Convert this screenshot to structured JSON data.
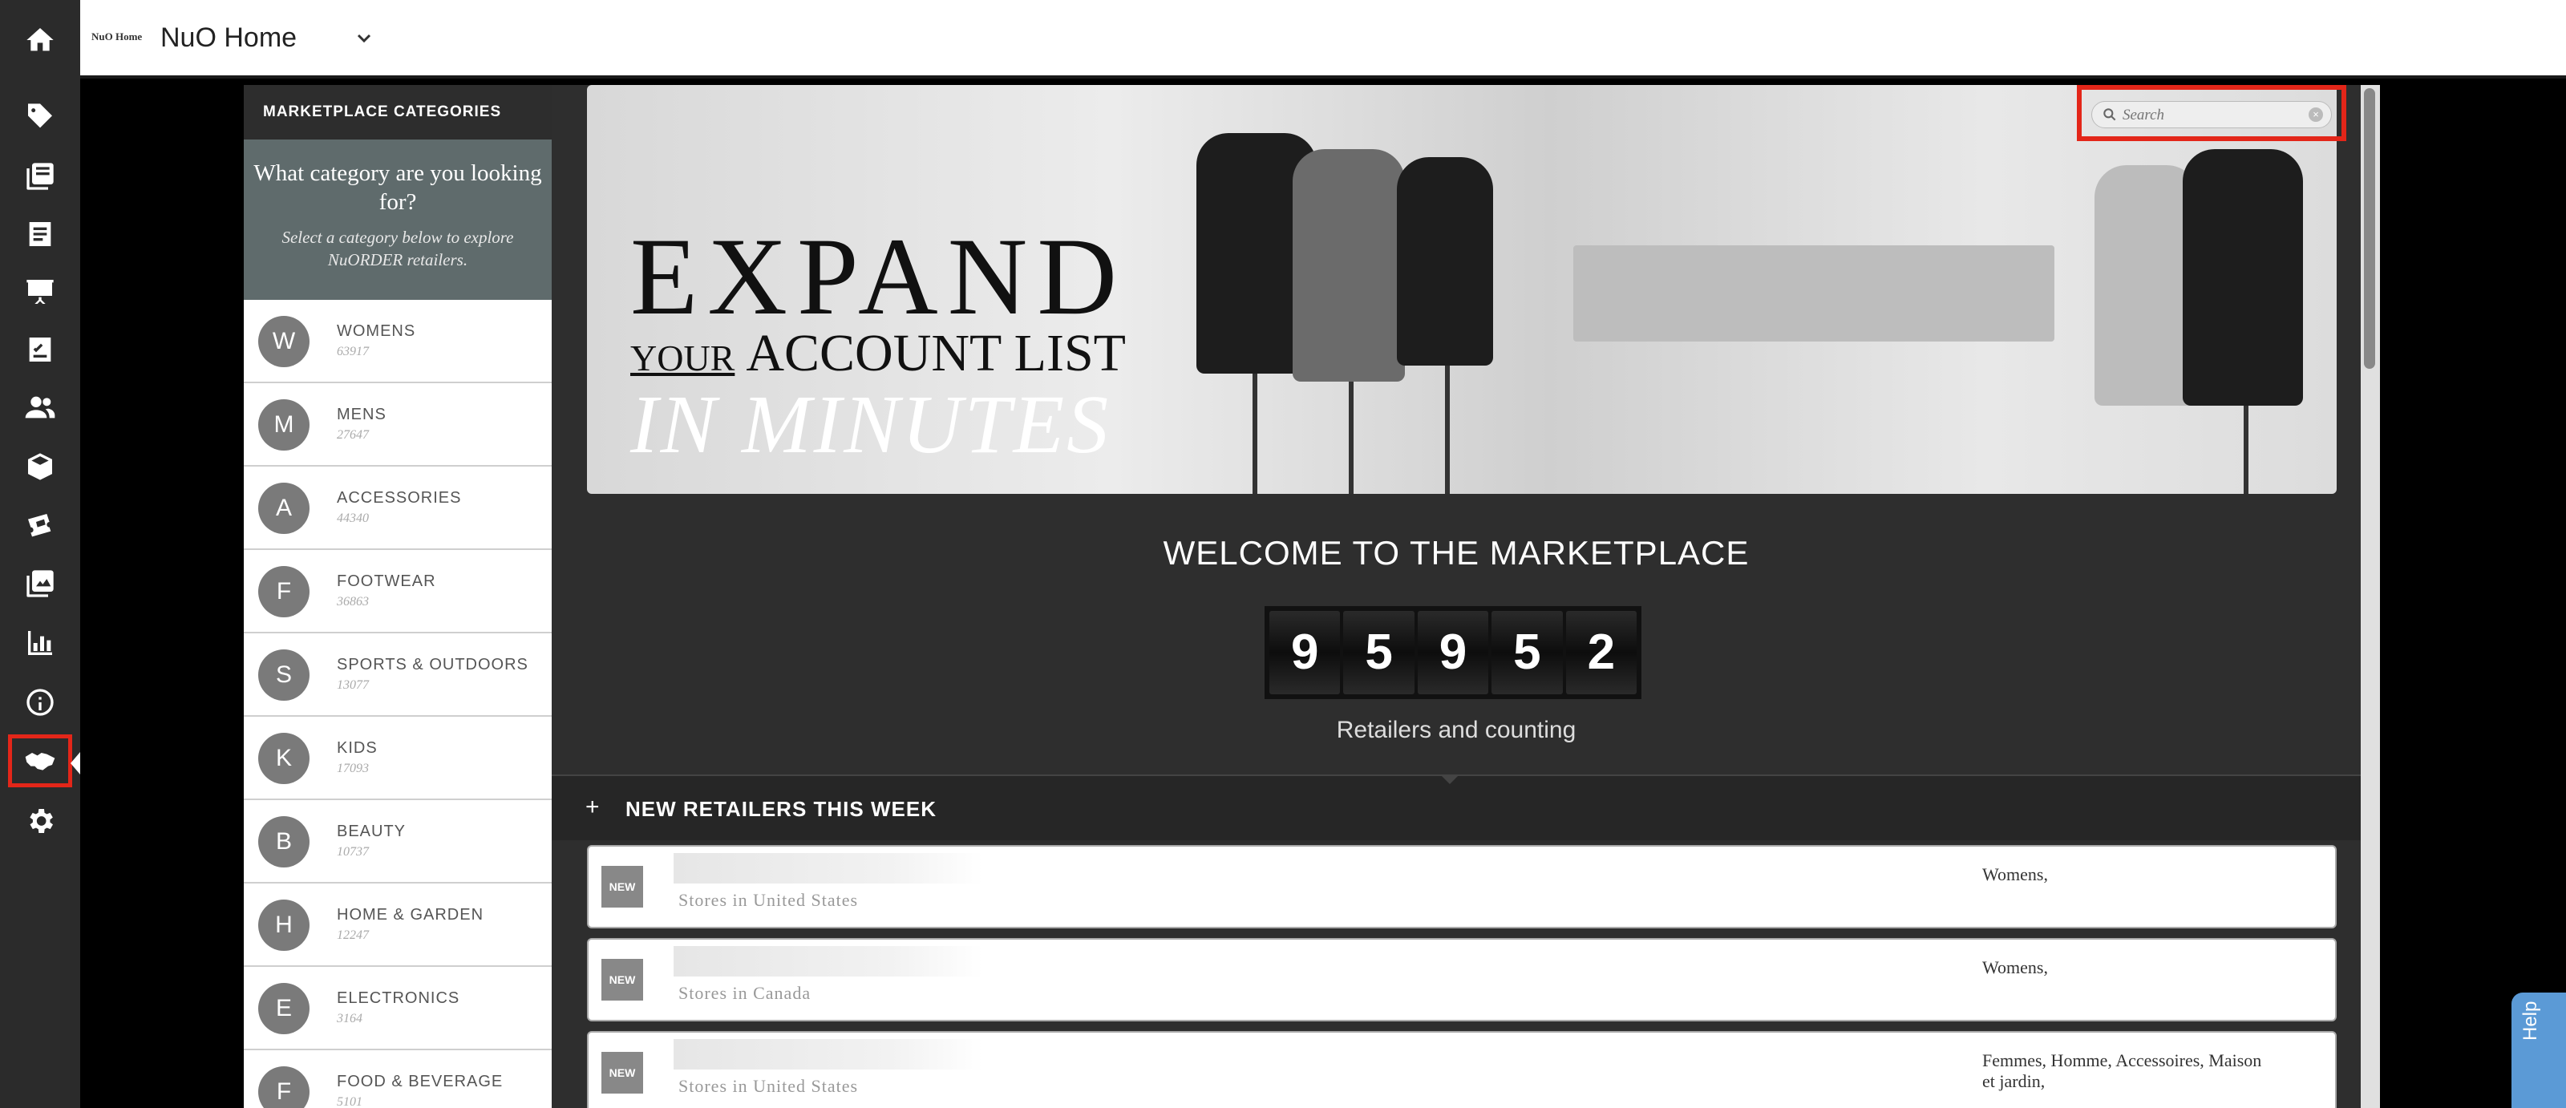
{
  "app": {
    "logo_text": "NuO Home",
    "title": "NuO Home"
  },
  "nav_icons": [
    "home-icon",
    "tag-icon",
    "catalog-icon",
    "list-icon",
    "presentation-icon",
    "checklist-icon",
    "people-icon",
    "box-icon",
    "tickets-icon",
    "image-icon",
    "chart-icon",
    "info-icon",
    "handshake-icon",
    "gear-icon"
  ],
  "categories": {
    "header": "MARKETPLACE CATEGORIES",
    "prompt_title": "What category are you looking for?",
    "prompt_sub": "Select a category below to explore NuORDER retailers.",
    "items": [
      {
        "letter": "W",
        "name": "WOMENS",
        "count": "63917"
      },
      {
        "letter": "M",
        "name": "MENS",
        "count": "27647"
      },
      {
        "letter": "A",
        "name": "ACCESSORIES",
        "count": "44340"
      },
      {
        "letter": "F",
        "name": "FOOTWEAR",
        "count": "36863"
      },
      {
        "letter": "S",
        "name": "SPORTS & OUTDOORS",
        "count": "13077"
      },
      {
        "letter": "K",
        "name": "KIDS",
        "count": "17093"
      },
      {
        "letter": "B",
        "name": "BEAUTY",
        "count": "10737"
      },
      {
        "letter": "H",
        "name": "HOME & GARDEN",
        "count": "12247"
      },
      {
        "letter": "E",
        "name": "ELECTRONICS",
        "count": "3164"
      },
      {
        "letter": "F",
        "name": "FOOD & BEVERAGE",
        "count": "5101"
      }
    ]
  },
  "hero": {
    "line1": "EXPAND",
    "line2_your": "YOUR",
    "line2_rest": "ACCOUNT LIST",
    "line3": "IN MINUTES"
  },
  "search": {
    "placeholder": "Search"
  },
  "marketplace": {
    "welcome": "WELCOME TO THE MARKETPLACE",
    "counter_digits": [
      "9",
      "5",
      "9",
      "5",
      "2"
    ],
    "counting_label": "Retailers and counting",
    "new_toggle": "+",
    "new_label": "NEW RETAILERS THIS WEEK"
  },
  "retailers": [
    {
      "badge": "NEW",
      "location": "Stores in United States",
      "tags": "Womens,"
    },
    {
      "badge": "NEW",
      "location": "Stores in Canada",
      "tags": "Womens,"
    },
    {
      "badge": "NEW",
      "location": "Stores in United States",
      "tags": "Femmes, Homme, Accessoires, Maison et jardin,"
    }
  ],
  "help": {
    "label": "Help"
  }
}
